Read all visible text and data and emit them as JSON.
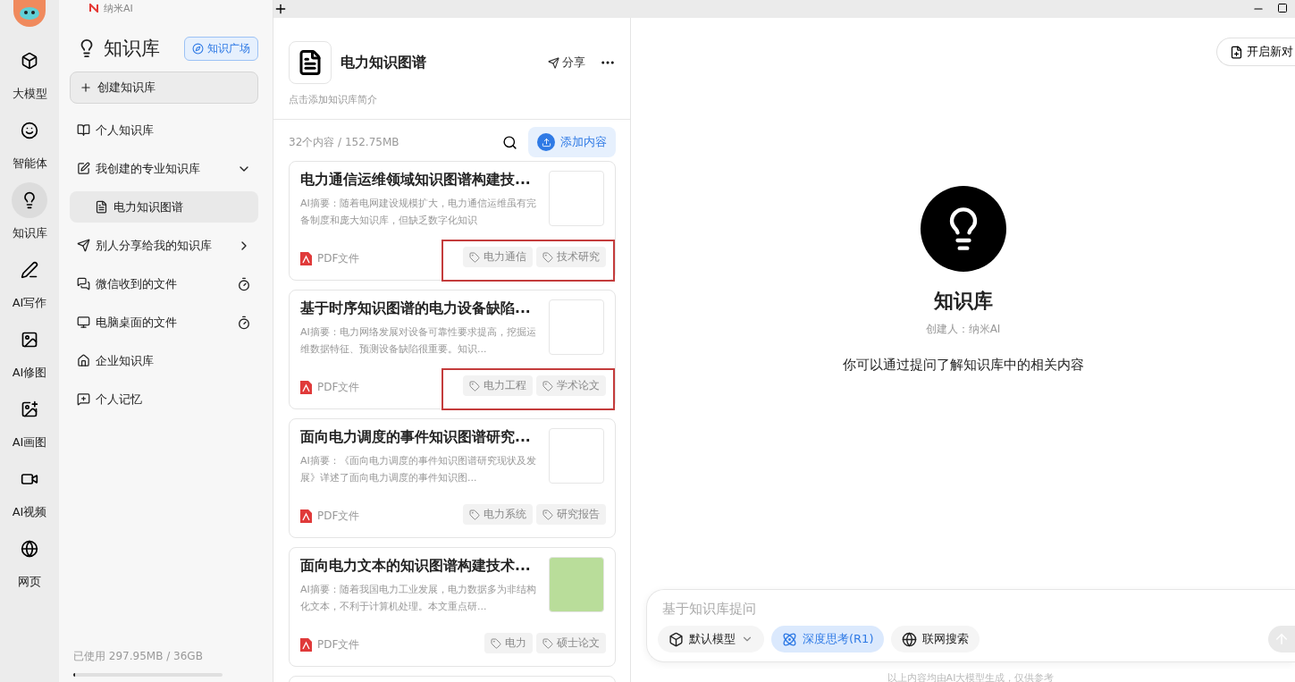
{
  "app_tab": {
    "title": "纳米AI"
  },
  "rail": [
    {
      "label": "大模型",
      "selected": false
    },
    {
      "label": "智能体",
      "selected": false
    },
    {
      "label": "知识库",
      "selected": true
    },
    {
      "label": "AI写作",
      "selected": false
    },
    {
      "label": "AI修图",
      "selected": false
    },
    {
      "label": "AI画图",
      "selected": false
    },
    {
      "label": "AI视频",
      "selected": false
    },
    {
      "label": "网页",
      "selected": false
    }
  ],
  "sidebar": {
    "title": "知识库",
    "plaza_button": "知识广场",
    "create_button": "创建知识库",
    "items": [
      {
        "label": "个人知识库",
        "kind": "link",
        "selected": false
      },
      {
        "label": "我创建的专业知识库",
        "kind": "group",
        "expanded": true,
        "selected": false,
        "children": [
          {
            "label": "电力知识图谱",
            "selected": true
          }
        ]
      },
      {
        "label": "别人分享给我的知识库",
        "kind": "group",
        "expanded": false,
        "selected": false
      },
      {
        "label": "微信收到的文件",
        "kind": "synced",
        "selected": false
      },
      {
        "label": "电脑桌面的文件",
        "kind": "synced",
        "selected": false
      },
      {
        "label": "企业知识库",
        "kind": "link",
        "selected": false
      },
      {
        "label": "个人记忆",
        "kind": "link",
        "selected": false
      }
    ],
    "storage": {
      "text": "已使用 297.95MB / 36GB",
      "level": 0.01
    }
  },
  "library": {
    "title": "电力知识图谱",
    "share": "分享",
    "description": "点击添加知识库简介",
    "count": "32个内容 / 152.75MB",
    "add_button": "添加内容",
    "documents": [
      {
        "title": "电力通信运维领域知识图谱构建技...",
        "summary": "AI摘要：随着电网建设规模扩大，电力通信运维虽有完备制度和庞大知识库，但缺乏数字化知识",
        "file_type": "PDF文件",
        "tags": [
          "电力通信",
          "技术研究"
        ],
        "highlighted": true,
        "thumbnail": {
          "color": "#ffffff"
        }
      },
      {
        "title": "基于时序知识图谱的电力设备缺陷...",
        "summary": "AI摘要：电力网络发展对设备可靠性要求提高，挖掘运维数据特征、预测设备缺陷很重要。知识...",
        "file_type": "PDF文件",
        "tags": [
          "电力工程",
          "学术论文"
        ],
        "highlighted": true,
        "thumbnail": {
          "color": "#ffffff"
        }
      },
      {
        "title": "面向电力调度的事件知识图谱研究...",
        "summary": "AI摘要：《面向电力调度的事件知识图谱研究现状及发展》详述了面向电力调度的事件知识图...",
        "file_type": "PDF文件",
        "tags": [
          "电力系统",
          "研究报告"
        ],
        "highlighted": false,
        "thumbnail": {
          "color": "#ffffff"
        }
      },
      {
        "title": "面向电力文本的知识图谱构建技术...",
        "summary": "AI摘要：随着我国电力工业发展，电力数据多为非结构化文本，不利于计算机处理。本文重点研...",
        "file_type": "PDF文件",
        "tags": [
          "电力",
          "硕士论文"
        ],
        "highlighted": false,
        "thumbnail": {
          "color": "#b9dd9a"
        }
      }
    ]
  },
  "chat": {
    "new_chat": "开启新对",
    "title": "知识库",
    "creator": "创建人：纳米AI",
    "hint": "你可以通过提问了解知识库中的相关内容",
    "placeholder": "基于知识库提问",
    "options": [
      {
        "label": "默认模型",
        "kind": "dropdown",
        "selected": false
      },
      {
        "label": "深度思考(R1)",
        "kind": "toggle",
        "selected": true
      },
      {
        "label": "联网搜索",
        "kind": "toggle",
        "selected": false
      }
    ],
    "disclaimer": "以上内容均由AI大模型生成，仅供参考"
  }
}
